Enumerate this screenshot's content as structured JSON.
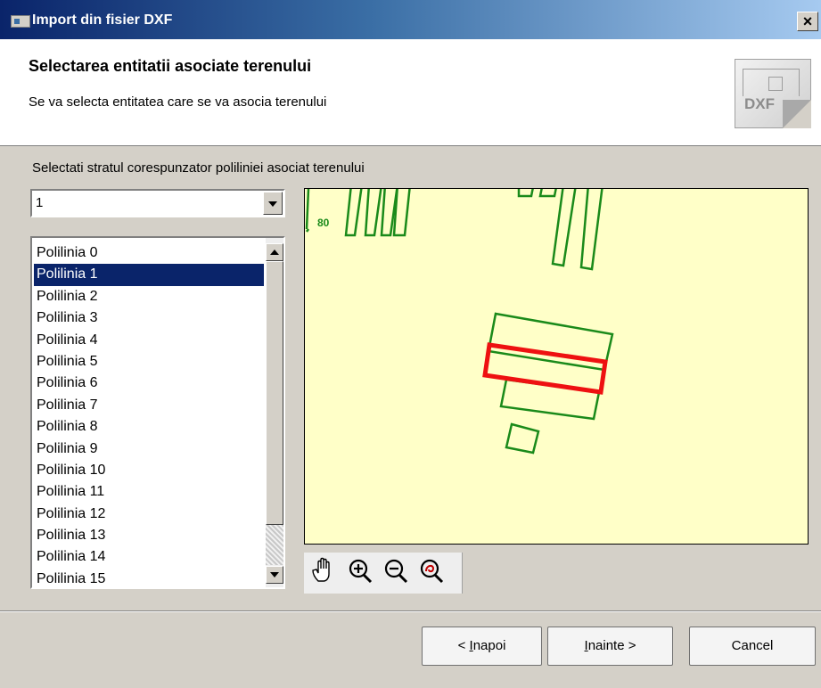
{
  "window": {
    "title": "Import din fisier DXF",
    "close_glyph": "×"
  },
  "header": {
    "title": "Selectarea entitatii asociate terenului",
    "subtitle": "Se va selecta entitatea care se va asocia terenului",
    "icon_label": "DXF"
  },
  "layer": {
    "label": "Selectati stratul corespunzator poliliniei asociat terenului",
    "selected": "1"
  },
  "polylines": {
    "selected_index": 1,
    "items": [
      "Polilinia 0",
      "Polilinia 1",
      "Polilinia 2",
      "Polilinia 3",
      "Polilinia 4",
      "Polilinia 5",
      "Polilinia 6",
      "Polilinia 7",
      "Polilinia 8",
      "Polilinia 9",
      "Polilinia 10",
      "Polilinia 11",
      "Polilinia 12",
      "Polilinia 13",
      "Polilinia 14",
      "Polilinia 15"
    ]
  },
  "preview": {
    "background": "#ffffc8",
    "entity_color": "#1a8a1a",
    "selected_color": "#ee1111",
    "text_fragment": "80"
  },
  "toolbar": {
    "tools": [
      "pan-icon",
      "zoom-in-icon",
      "zoom-out-icon",
      "zoom-extents-icon"
    ]
  },
  "footer": {
    "back_prefix": "< ",
    "back_accel": "I",
    "back_rest": "napoi",
    "next_accel": "I",
    "next_rest": "nainte >",
    "cancel": "Cancel"
  }
}
